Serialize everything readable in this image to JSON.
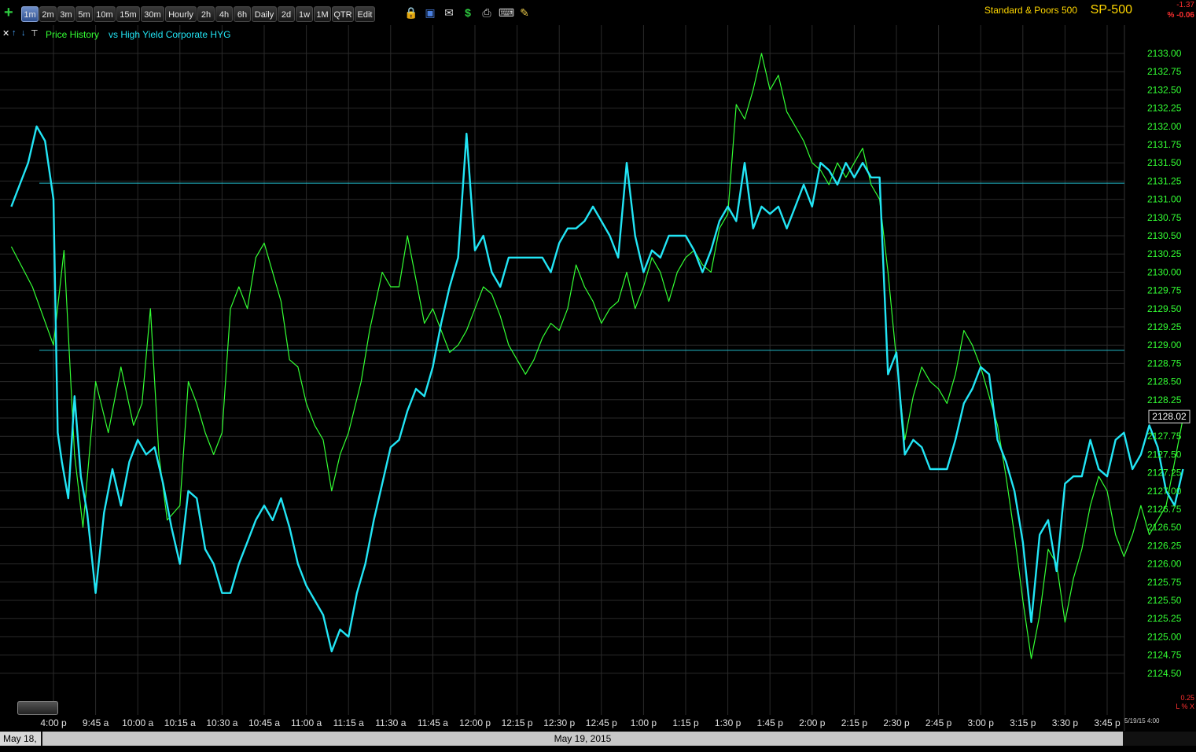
{
  "toolbar": {
    "timeframes": [
      "1m",
      "2m",
      "3m",
      "5m",
      "10m",
      "15m",
      "30m",
      "Hourly",
      "2h",
      "4h",
      "6h",
      "Daily",
      "2d",
      "1w",
      "1M",
      "QTR",
      "Edit"
    ],
    "active_timeframe": "1m",
    "icons": [
      "plus-icon",
      "lock-icon",
      "save-icon",
      "mail-icon",
      "dollar-icon",
      "print-icon",
      "keyboard-icon",
      "pencil-icon"
    ]
  },
  "symbol": {
    "name": "Standard & Poors 500",
    "ticker": "SP-500",
    "change_abs": "-1.37",
    "change_pct": "% -0.06"
  },
  "legend": {
    "series1": "Price History",
    "series2": "vs High Yield Corporate HYG"
  },
  "scale": {
    "value": "0.25",
    "controls": "L % X"
  },
  "latest_date": "5/19/15 4:00",
  "navigator": {
    "left_label": "May 18,",
    "main_label": "May 19, 2015"
  },
  "chart_data": {
    "type": "line",
    "x_tick_labels": [
      "4:00 p",
      "9:45 a",
      "10:00 a",
      "10:15 a",
      "10:30 a",
      "10:45 a",
      "11:00 a",
      "11:15 a",
      "11:30 a",
      "11:45 a",
      "12:00 p",
      "12:15 p",
      "12:30 p",
      "12:45 p",
      "1:00 p",
      "1:15 p",
      "1:30 p",
      "1:45 p",
      "2:00 p",
      "2:15 p",
      "2:30 p",
      "2:45 p",
      "3:00 p",
      "3:15 p",
      "3:30 p",
      "3:45 p"
    ],
    "y_tick_labels": [
      "2133.00",
      "2132.75",
      "2132.50",
      "2132.25",
      "2132.00",
      "2131.75",
      "2131.50",
      "2131.25",
      "2131.00",
      "2130.75",
      "2130.50",
      "2130.25",
      "2130.00",
      "2129.75",
      "2129.50",
      "2129.25",
      "2129.00",
      "2128.75",
      "2128.50",
      "2128.25",
      "2128.02",
      "2127.75",
      "2127.50",
      "2127.25",
      "2127.00",
      "2126.75",
      "2126.50",
      "2126.25",
      "2126.00",
      "2125.75",
      "2125.50",
      "2125.25",
      "2125.00",
      "2124.75",
      "2124.50"
    ],
    "ylim": [
      2124.3,
      2133.2
    ],
    "last_price": "2128.02",
    "horizontal_lines": [
      2131.22,
      2128.93
    ],
    "series": [
      {
        "name": "Price History",
        "color": "#33ff33",
        "points": [
          [
            -1,
            2130.35
          ],
          [
            -0.5,
            2129.8
          ],
          [
            0,
            2129.0
          ],
          [
            0.25,
            2130.3
          ],
          [
            0.5,
            2127.5
          ],
          [
            0.7,
            2126.5
          ],
          [
            1,
            2128.5
          ],
          [
            1.3,
            2127.8
          ],
          [
            1.6,
            2128.7
          ],
          [
            1.9,
            2127.9
          ],
          [
            2.1,
            2128.2
          ],
          [
            2.3,
            2129.5
          ],
          [
            2.5,
            2127.5
          ],
          [
            2.7,
            2126.6
          ],
          [
            3,
            2126.8
          ],
          [
            3.2,
            2128.5
          ],
          [
            3.4,
            2128.2
          ],
          [
            3.6,
            2127.8
          ],
          [
            3.8,
            2127.5
          ],
          [
            4,
            2127.8
          ],
          [
            4.2,
            2129.5
          ],
          [
            4.4,
            2129.8
          ],
          [
            4.6,
            2129.5
          ],
          [
            4.8,
            2130.2
          ],
          [
            5,
            2130.4
          ],
          [
            5.2,
            2130.0
          ],
          [
            5.4,
            2129.6
          ],
          [
            5.6,
            2128.8
          ],
          [
            5.8,
            2128.7
          ],
          [
            6,
            2128.2
          ],
          [
            6.2,
            2127.9
          ],
          [
            6.4,
            2127.7
          ],
          [
            6.6,
            2127.0
          ],
          [
            6.8,
            2127.5
          ],
          [
            7,
            2127.8
          ],
          [
            7.3,
            2128.5
          ],
          [
            7.5,
            2129.2
          ],
          [
            7.8,
            2130.0
          ],
          [
            8,
            2129.8
          ],
          [
            8.2,
            2129.8
          ],
          [
            8.4,
            2130.5
          ],
          [
            8.6,
            2129.9
          ],
          [
            8.8,
            2129.3
          ],
          [
            9,
            2129.5
          ],
          [
            9.2,
            2129.2
          ],
          [
            9.4,
            2128.9
          ],
          [
            9.6,
            2129.0
          ],
          [
            9.8,
            2129.2
          ],
          [
            10,
            2129.5
          ],
          [
            10.2,
            2129.8
          ],
          [
            10.4,
            2129.7
          ],
          [
            10.6,
            2129.4
          ],
          [
            10.8,
            2129.0
          ],
          [
            11,
            2128.8
          ],
          [
            11.2,
            2128.6
          ],
          [
            11.4,
            2128.8
          ],
          [
            11.6,
            2129.1
          ],
          [
            11.8,
            2129.3
          ],
          [
            12,
            2129.2
          ],
          [
            12.2,
            2129.5
          ],
          [
            12.4,
            2130.1
          ],
          [
            12.6,
            2129.8
          ],
          [
            12.8,
            2129.6
          ],
          [
            13,
            2129.3
          ],
          [
            13.2,
            2129.5
          ],
          [
            13.4,
            2129.6
          ],
          [
            13.6,
            2130.0
          ],
          [
            13.8,
            2129.5
          ],
          [
            14,
            2129.8
          ],
          [
            14.2,
            2130.2
          ],
          [
            14.4,
            2130.0
          ],
          [
            14.6,
            2129.6
          ],
          [
            14.8,
            2130.0
          ],
          [
            15,
            2130.2
          ],
          [
            15.2,
            2130.3
          ],
          [
            15.4,
            2130.1
          ],
          [
            15.6,
            2130.0
          ],
          [
            15.8,
            2130.6
          ],
          [
            16,
            2130.8
          ],
          [
            16.2,
            2132.3
          ],
          [
            16.4,
            2132.1
          ],
          [
            16.6,
            2132.5
          ],
          [
            16.8,
            2133.0
          ],
          [
            17,
            2132.5
          ],
          [
            17.2,
            2132.7
          ],
          [
            17.4,
            2132.2
          ],
          [
            17.6,
            2132.0
          ],
          [
            17.8,
            2131.8
          ],
          [
            18,
            2131.5
          ],
          [
            18.2,
            2131.4
          ],
          [
            18.4,
            2131.2
          ],
          [
            18.6,
            2131.5
          ],
          [
            18.8,
            2131.3
          ],
          [
            19,
            2131.5
          ],
          [
            19.2,
            2131.7
          ],
          [
            19.4,
            2131.2
          ],
          [
            19.6,
            2131.0
          ],
          [
            19.8,
            2130.0
          ],
          [
            20,
            2128.8
          ],
          [
            20.2,
            2127.7
          ],
          [
            20.4,
            2128.3
          ],
          [
            20.6,
            2128.7
          ],
          [
            20.8,
            2128.5
          ],
          [
            21,
            2128.4
          ],
          [
            21.2,
            2128.2
          ],
          [
            21.4,
            2128.6
          ],
          [
            21.6,
            2129.2
          ],
          [
            21.8,
            2129.0
          ],
          [
            22,
            2128.7
          ],
          [
            22.2,
            2128.3
          ],
          [
            22.4,
            2127.9
          ],
          [
            22.6,
            2127.2
          ],
          [
            22.8,
            2126.4
          ],
          [
            23,
            2125.5
          ],
          [
            23.2,
            2124.7
          ],
          [
            23.4,
            2125.3
          ],
          [
            23.6,
            2126.2
          ],
          [
            23.8,
            2126.0
          ],
          [
            24,
            2125.2
          ],
          [
            24.2,
            2125.8
          ],
          [
            24.4,
            2126.2
          ],
          [
            24.6,
            2126.8
          ],
          [
            24.8,
            2127.2
          ],
          [
            25,
            2127.0
          ],
          [
            25.2,
            2126.4
          ],
          [
            25.4,
            2126.1
          ],
          [
            25.6,
            2126.4
          ],
          [
            25.8,
            2126.8
          ],
          [
            26,
            2126.4
          ],
          [
            26.2,
            2126.6
          ],
          [
            26.4,
            2126.8
          ],
          [
            26.6,
            2127.4
          ],
          [
            26.8,
            2128.0
          ]
        ]
      },
      {
        "name": "vs High Yield Corporate HYG",
        "color": "#22e5f5",
        "points": [
          [
            -1,
            2130.9
          ],
          [
            -0.8,
            2131.2
          ],
          [
            -0.6,
            2131.5
          ],
          [
            -0.4,
            2132.0
          ],
          [
            -0.2,
            2131.8
          ],
          [
            0,
            2131.0
          ],
          [
            0.1,
            2127.8
          ],
          [
            0.2,
            2127.4
          ],
          [
            0.35,
            2126.9
          ],
          [
            0.5,
            2128.3
          ],
          [
            0.65,
            2127.2
          ],
          [
            0.8,
            2126.7
          ],
          [
            1,
            2125.6
          ],
          [
            1.2,
            2126.7
          ],
          [
            1.4,
            2127.3
          ],
          [
            1.6,
            2126.8
          ],
          [
            1.8,
            2127.4
          ],
          [
            2,
            2127.7
          ],
          [
            2.2,
            2127.5
          ],
          [
            2.4,
            2127.6
          ],
          [
            2.6,
            2127.1
          ],
          [
            2.8,
            2126.5
          ],
          [
            3,
            2126.0
          ],
          [
            3.2,
            2127.0
          ],
          [
            3.4,
            2126.9
          ],
          [
            3.6,
            2126.2
          ],
          [
            3.8,
            2126.0
          ],
          [
            4,
            2125.6
          ],
          [
            4.2,
            2125.6
          ],
          [
            4.4,
            2126.0
          ],
          [
            4.6,
            2126.3
          ],
          [
            4.8,
            2126.6
          ],
          [
            5,
            2126.8
          ],
          [
            5.2,
            2126.6
          ],
          [
            5.4,
            2126.9
          ],
          [
            5.6,
            2126.5
          ],
          [
            5.8,
            2126.0
          ],
          [
            6,
            2125.7
          ],
          [
            6.2,
            2125.5
          ],
          [
            6.4,
            2125.3
          ],
          [
            6.6,
            2124.8
          ],
          [
            6.8,
            2125.1
          ],
          [
            7,
            2125.0
          ],
          [
            7.2,
            2125.6
          ],
          [
            7.4,
            2126.0
          ],
          [
            7.6,
            2126.6
          ],
          [
            7.8,
            2127.1
          ],
          [
            8,
            2127.6
          ],
          [
            8.2,
            2127.7
          ],
          [
            8.4,
            2128.1
          ],
          [
            8.6,
            2128.4
          ],
          [
            8.8,
            2128.3
          ],
          [
            9,
            2128.7
          ],
          [
            9.2,
            2129.3
          ],
          [
            9.4,
            2129.8
          ],
          [
            9.6,
            2130.2
          ],
          [
            9.8,
            2131.9
          ],
          [
            10,
            2130.3
          ],
          [
            10.2,
            2130.5
          ],
          [
            10.4,
            2130.0
          ],
          [
            10.6,
            2129.8
          ],
          [
            10.8,
            2130.2
          ],
          [
            11,
            2130.2
          ],
          [
            11.2,
            2130.2
          ],
          [
            11.4,
            2130.2
          ],
          [
            11.6,
            2130.2
          ],
          [
            11.8,
            2130.0
          ],
          [
            12,
            2130.4
          ],
          [
            12.2,
            2130.6
          ],
          [
            12.4,
            2130.6
          ],
          [
            12.6,
            2130.7
          ],
          [
            12.8,
            2130.9
          ],
          [
            13,
            2130.7
          ],
          [
            13.2,
            2130.5
          ],
          [
            13.4,
            2130.2
          ],
          [
            13.6,
            2131.5
          ],
          [
            13.8,
            2130.5
          ],
          [
            14,
            2130.0
          ],
          [
            14.2,
            2130.3
          ],
          [
            14.4,
            2130.2
          ],
          [
            14.6,
            2130.5
          ],
          [
            14.8,
            2130.5
          ],
          [
            15,
            2130.5
          ],
          [
            15.2,
            2130.3
          ],
          [
            15.4,
            2130.0
          ],
          [
            15.6,
            2130.3
          ],
          [
            15.8,
            2130.7
          ],
          [
            16,
            2130.9
          ],
          [
            16.2,
            2130.7
          ],
          [
            16.4,
            2131.5
          ],
          [
            16.6,
            2130.6
          ],
          [
            16.8,
            2130.9
          ],
          [
            17,
            2130.8
          ],
          [
            17.2,
            2130.9
          ],
          [
            17.4,
            2130.6
          ],
          [
            17.6,
            2130.9
          ],
          [
            17.8,
            2131.2
          ],
          [
            18,
            2130.9
          ],
          [
            18.2,
            2131.5
          ],
          [
            18.4,
            2131.4
          ],
          [
            18.6,
            2131.2
          ],
          [
            18.8,
            2131.5
          ],
          [
            19,
            2131.3
          ],
          [
            19.2,
            2131.5
          ],
          [
            19.4,
            2131.3
          ],
          [
            19.6,
            2131.3
          ],
          [
            19.8,
            2128.6
          ],
          [
            20,
            2128.9
          ],
          [
            20.2,
            2127.5
          ],
          [
            20.4,
            2127.7
          ],
          [
            20.6,
            2127.6
          ],
          [
            20.8,
            2127.3
          ],
          [
            21,
            2127.3
          ],
          [
            21.2,
            2127.3
          ],
          [
            21.4,
            2127.7
          ],
          [
            21.6,
            2128.2
          ],
          [
            21.8,
            2128.4
          ],
          [
            22,
            2128.7
          ],
          [
            22.2,
            2128.6
          ],
          [
            22.4,
            2127.7
          ],
          [
            22.6,
            2127.4
          ],
          [
            22.8,
            2127.0
          ],
          [
            23,
            2126.3
          ],
          [
            23.2,
            2125.2
          ],
          [
            23.4,
            2126.4
          ],
          [
            23.6,
            2126.6
          ],
          [
            23.8,
            2125.9
          ],
          [
            24,
            2127.1
          ],
          [
            24.2,
            2127.2
          ],
          [
            24.4,
            2127.2
          ],
          [
            24.6,
            2127.7
          ],
          [
            24.8,
            2127.3
          ],
          [
            25,
            2127.2
          ],
          [
            25.2,
            2127.7
          ],
          [
            25.4,
            2127.8
          ],
          [
            25.6,
            2127.3
          ],
          [
            25.8,
            2127.5
          ],
          [
            26,
            2127.9
          ],
          [
            26.2,
            2127.6
          ],
          [
            26.4,
            2127.0
          ],
          [
            26.6,
            2126.8
          ],
          [
            26.8,
            2127.3
          ]
        ]
      }
    ]
  }
}
